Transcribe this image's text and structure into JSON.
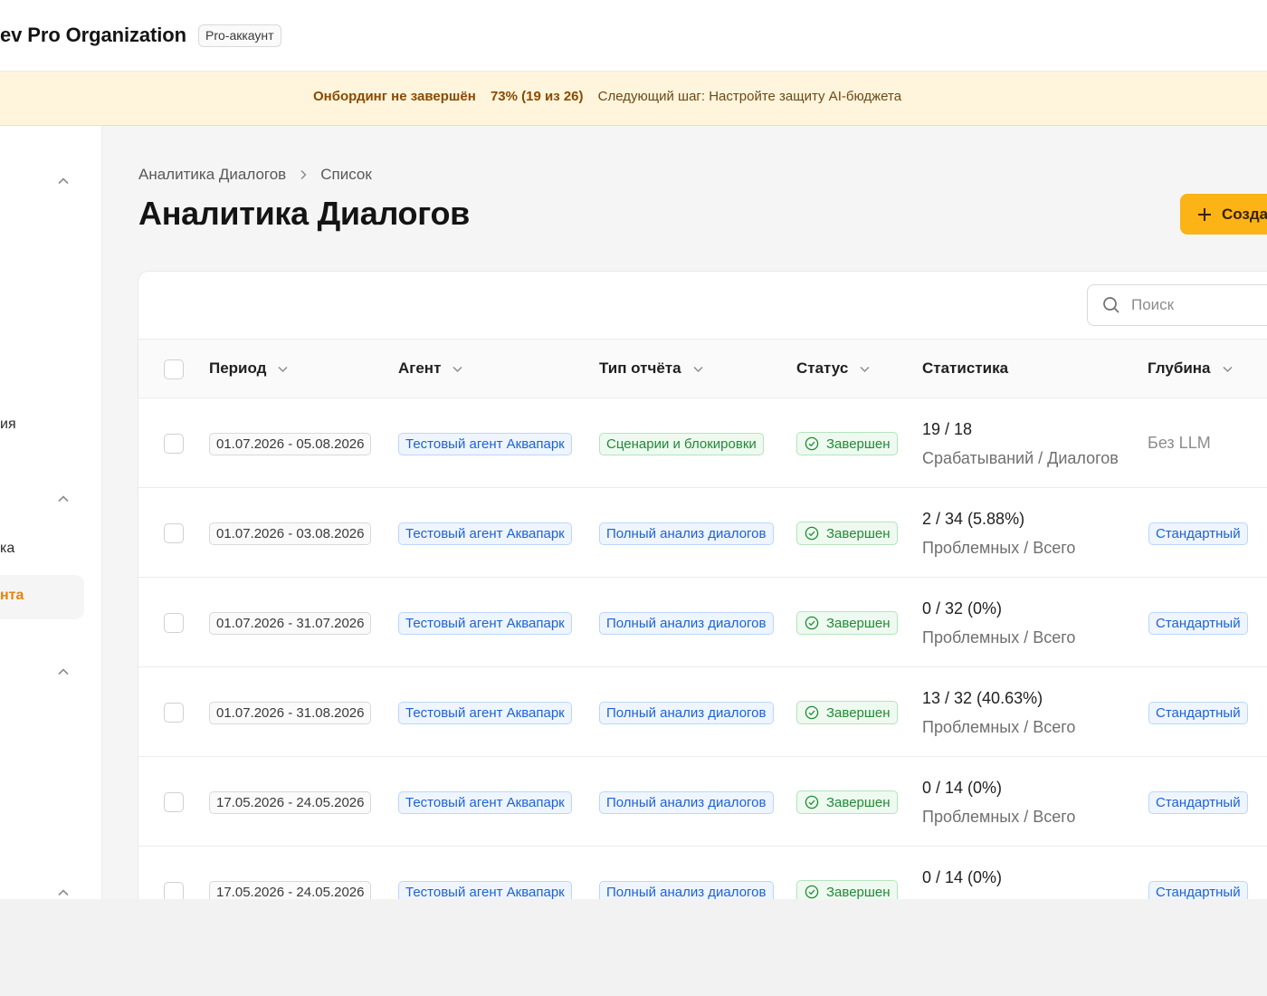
{
  "header": {
    "org_title": "ev Pro Organization",
    "account_badge": "Pro-аккаунт"
  },
  "banner": {
    "title": "Онбординг не завершён",
    "progress": "73% (19 из 26)",
    "next_step": "Следующий шаг: Настройте защиту AI-бюджета"
  },
  "sidebar": {
    "labels": [
      "ия",
      "ка"
    ],
    "active_label": "нта"
  },
  "breadcrumb": {
    "root": "Аналитика Диалогов",
    "current": "Список"
  },
  "page": {
    "title": "Аналитика Диалогов",
    "create_label": "Созда"
  },
  "search": {
    "placeholder": "Поиск"
  },
  "table": {
    "columns": {
      "period": "Период",
      "agent": "Агент",
      "type": "Тип отчёта",
      "status": "Статус",
      "stats": "Статистика",
      "depth": "Глубина"
    },
    "rows": [
      {
        "period": "01.07.2026 - 05.08.2026",
        "agent": "Тестовый агент Аквапарк",
        "type": "Сценарии и блокировки",
        "status": "Завершен",
        "stat_main": "19 / 18",
        "stat_sub": "Срабатываний / Диалогов",
        "depth": "Без LLM"
      },
      {
        "period": "01.07.2026 - 03.08.2026",
        "agent": "Тестовый агент Аквапарк",
        "type": "Полный анализ диалогов",
        "status": "Завершен",
        "stat_main": "2 / 34 (5.88%)",
        "stat_sub": "Проблемных / Всего",
        "depth": "Стандартный"
      },
      {
        "period": "01.07.2026 - 31.07.2026",
        "agent": "Тестовый агент Аквапарк",
        "type": "Полный анализ диалогов",
        "status": "Завершен",
        "stat_main": "0 / 32 (0%)",
        "stat_sub": "Проблемных / Всего",
        "depth": "Стандартный"
      },
      {
        "period": "01.07.2026 - 31.08.2026",
        "agent": "Тестовый агент Аквапарк",
        "type": "Полный анализ диалогов",
        "status": "Завершен",
        "stat_main": "13 / 32 (40.63%)",
        "stat_sub": "Проблемных / Всего",
        "depth": "Стандартный"
      },
      {
        "period": "17.05.2026 - 24.05.2026",
        "agent": "Тестовый агент Аквапарк",
        "type": "Полный анализ диалогов",
        "status": "Завершен",
        "stat_main": "0 / 14 (0%)",
        "stat_sub": "Проблемных / Всего",
        "depth": "Стандартный"
      },
      {
        "period": "17.05.2026 - 24.05.2026",
        "agent": "Тестовый агент Аквапарк",
        "type": "Полный анализ диалогов",
        "status": "Завершен",
        "stat_main": "0 / 14 (0%)",
        "stat_sub": "",
        "depth": "Стандартный"
      }
    ]
  },
  "icons": {
    "chevron_up": "chevron-up-icon",
    "chevron_right": "chevron-right-icon",
    "chevron_down": "chevron-down-icon",
    "plus": "plus-icon",
    "search": "search-icon",
    "check_circle": "check-circle-icon"
  },
  "colors": {
    "accent": "#fbb316",
    "active_nav": "#e8820c",
    "banner_bg": "#fff4dc",
    "tag_blue": "#1d62d6",
    "tag_green": "#218a35"
  }
}
